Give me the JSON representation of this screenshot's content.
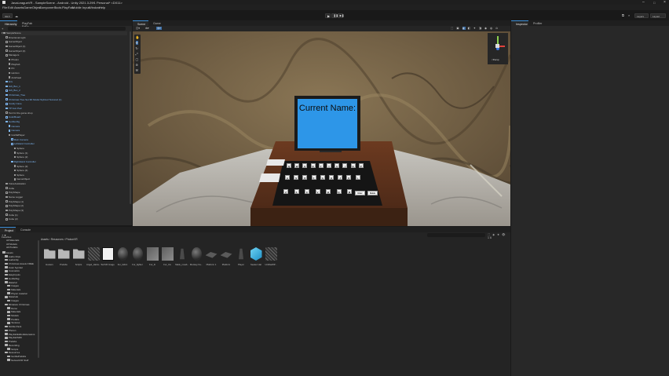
{
  "window": {
    "title": "JavaLeagueVR - SampleScene - Android - Unity 2021.3.29f1 Personal* <DX11>"
  },
  "menu": [
    "File",
    "Edit",
    "Assets",
    "GameObject",
    "Component",
    "Tools",
    "PlayFab",
    "Mobile Input",
    "Window",
    "Help"
  ],
  "toolbar": {
    "account_label": "GE ▾",
    "layers_label": "Layers",
    "layout_label": "Layout"
  },
  "left_tabs": [
    "Hierarchy",
    "PlayFab EdEx"
  ],
  "hierarchy": {
    "scene_name": "SampleScene",
    "items": [
      {
        "label": "Directional Light",
        "indent": 1,
        "prefab": false
      },
      {
        "label": "GameObject",
        "indent": 1,
        "prefab": false
      },
      {
        "label": "GameObject (1)",
        "indent": 1,
        "prefab": false
      },
      {
        "label": "GameObject (2)",
        "indent": 1,
        "prefab": false
      },
      {
        "label": "Managers",
        "indent": 1,
        "prefab": false
      },
      {
        "label": "Photon",
        "indent": 2,
        "prefab": false
      },
      {
        "label": "PlayFab",
        "indent": 2,
        "prefab": false
      },
      {
        "label": "PC",
        "indent": 2,
        "prefab": false
      },
      {
        "label": "Horizon",
        "indent": 2,
        "prefab": false
      },
      {
        "label": "Anticheat",
        "indent": 2,
        "prefab": false
      },
      {
        "label": "Env",
        "indent": 1,
        "prefab": true
      },
      {
        "label": "Gift_Box_1",
        "indent": 1,
        "prefab": true
      },
      {
        "label": "Gift_Box_2",
        "indent": 1,
        "prefab": true
      },
      {
        "label": "Christmas_Tree",
        "indent": 1,
        "prefab": true
      },
      {
        "label": "Christmas Tree Set 3D Model Stylized Textured (1)",
        "indent": 1,
        "prefab": true
      },
      {
        "label": "Candy Cane",
        "indent": 1,
        "prefab": true
      },
      {
        "label": "TP Gun Pad",
        "indent": 1,
        "prefab": true
      },
      {
        "label": "Text for the game shop",
        "indent": 1,
        "prefab": false
      },
      {
        "label": "ColorBoard",
        "indent": 1,
        "prefab": true
      },
      {
        "label": "Gorilla Rig",
        "indent": 1,
        "prefab": true
      },
      {
        "label": "Camera",
        "indent": 2,
        "prefab": true
      },
      {
        "label": "Camera",
        "indent": 2,
        "prefab": true
      },
      {
        "label": "GorillaPlayer",
        "indent": 2,
        "prefab": false
      },
      {
        "label": "Main Camera",
        "indent": 3,
        "prefab": true
      },
      {
        "label": "LeftHand Controller",
        "indent": 3,
        "prefab": true
      },
      {
        "label": "Sphere",
        "indent": 4,
        "prefab": false
      },
      {
        "label": "Sphere (1)",
        "indent": 4,
        "prefab": false
      },
      {
        "label": "Sphere (2)",
        "indent": 4,
        "prefab": false
      },
      {
        "label": "RightHand Controller",
        "indent": 3,
        "prefab": true
      },
      {
        "label": "Sphere (3)",
        "indent": 4,
        "prefab": false
      },
      {
        "label": "Sphere (4)",
        "indent": 4,
        "prefab": false
      },
      {
        "label": "Sphere",
        "indent": 4,
        "prefab": false
      },
      {
        "label": "GameObject",
        "indent": 4,
        "prefab": false
      },
      {
        "label": "VoiceAssistation",
        "indent": 1,
        "prefab": false
      },
      {
        "label": "Cube",
        "indent": 1,
        "prefab": false
      },
      {
        "label": "PolyShape",
        "indent": 1,
        "prefab": false
      },
      {
        "label": "Name Logger",
        "indent": 1,
        "prefab": false
      },
      {
        "label": "PolyShape (1)",
        "indent": 1,
        "prefab": false
      },
      {
        "label": "PolyShape (2)",
        "indent": 1,
        "prefab": false
      },
      {
        "label": "PolyShape (3)",
        "indent": 1,
        "prefab": false
      },
      {
        "label": "Cube (1)",
        "indent": 1,
        "prefab": false
      },
      {
        "label": "Cube (2)",
        "indent": 1,
        "prefab": false
      }
    ]
  },
  "center_tabs": [
    "Scene",
    "Game"
  ],
  "right_tabs": [
    "Inspector",
    "Profiler"
  ],
  "scene": {
    "monitor_text": "Current Name:",
    "gizmo_label": "<Persp",
    "keys_row1": [
      "Q",
      "W",
      "E",
      "R",
      "T",
      "Y",
      "U",
      "I",
      "O",
      "P"
    ],
    "keys_row2": [
      "A",
      "S",
      "D",
      "F",
      "G",
      "H",
      "J",
      "K",
      "L"
    ],
    "keys_row3": [
      "Z",
      "X",
      "C",
      "V",
      "B",
      "N",
      "M"
    ],
    "key_enter": "Enter",
    "key_delete": "Delete"
  },
  "bottom_tabs": [
    "Project",
    "Console"
  ],
  "breadcrumb": [
    "Assets",
    "Resources",
    "PhotonVR"
  ],
  "project_tree": {
    "top_items": [
      "Favorites",
      "All Materials",
      "All Models",
      "All Prefabs"
    ],
    "items": [
      {
        "label": "Assets",
        "indent": 0
      },
      {
        "label": "Audio Clips",
        "indent": 1
      },
      {
        "label": "AudioClip",
        "indent": 1
      },
      {
        "label": "Christmas Assets FREE",
        "indent": 1
      },
      {
        "label": "Color Symbol",
        "indent": 1
      },
      {
        "label": "Cosmetics",
        "indent": 1
      },
      {
        "label": "EasyInputs",
        "indent": 1
      },
      {
        "label": "GorillaTag",
        "indent": 1
      },
      {
        "label": "Material",
        "indent": 1
      },
      {
        "label": "Images",
        "indent": 2
      },
      {
        "label": "Materials",
        "indent": 2
      },
      {
        "label": "Physic material",
        "indent": 2
      },
      {
        "label": "Materials",
        "indent": 1
      },
      {
        "label": "Images",
        "indent": 2
      },
      {
        "label": "Miniature Christmas",
        "indent": 1
      },
      {
        "label": "Demo",
        "indent": 2
      },
      {
        "label": "Materials",
        "indent": 2
      },
      {
        "label": "Models",
        "indent": 2
      },
      {
        "label": "Prefabs",
        "indent": 2
      },
      {
        "label": "Textures",
        "indent": 2
      },
      {
        "label": "Mobile Pack",
        "indent": 1
      },
      {
        "label": "Photon",
        "indent": 1
      },
      {
        "label": "PlayFabEditorExtensions",
        "indent": 1
      },
      {
        "label": "PlayFabSDK",
        "indent": 1
      },
      {
        "label": "Prefabs",
        "indent": 1
      },
      {
        "label": "Recording",
        "indent": 1
      },
      {
        "label": "Scripts",
        "indent": 2
      },
      {
        "label": "Resources",
        "indent": 1
      },
      {
        "label": "GorillaPrefabs",
        "indent": 2
      },
      {
        "label": "NetworkVR Stuff",
        "indent": 2
      }
    ]
  },
  "assets": [
    {
      "label": "Hosters",
      "kind": "folder"
    },
    {
      "label": "Prefabs",
      "kind": "folder"
    },
    {
      "label": "Scripts",
      "kind": "folder"
    },
    {
      "label": "Angel_Hairw...",
      "kind": "texture-dark"
    },
    {
      "label": "TextVR Image",
      "kind": "hash"
    },
    {
      "label": "Fur_fabric",
      "kind": "sphere"
    },
    {
      "label": "Fur_fighter",
      "kind": "sphere"
    },
    {
      "label": "Fur_D",
      "kind": "grey"
    },
    {
      "label": "Fur_Iris",
      "kind": "grey"
    },
    {
      "label": "Mask_moab...",
      "kind": "hand"
    },
    {
      "label": "Monkey Fa...",
      "kind": "sphere"
    },
    {
      "label": "Platform 1",
      "kind": "plate"
    },
    {
      "label": "Platform",
      "kind": "plate"
    },
    {
      "label": "Player",
      "kind": "hand"
    },
    {
      "label": "Seeker Hat",
      "kind": "cube"
    },
    {
      "label": "UnlitbaWP...",
      "kind": "texture-dark"
    }
  ],
  "colors": {
    "accent": "#3c8fd8",
    "screen_blue": "#2d96e8",
    "desk_brown": "#5a2f1b",
    "prefab_text": "#7eb6f2"
  }
}
